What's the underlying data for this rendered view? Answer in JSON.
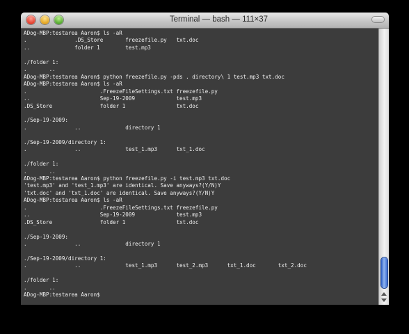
{
  "window": {
    "title": "Terminal — bash — 111×37"
  },
  "terminal": {
    "lines": [
      "ADog-MBP:testarea Aaron$ ls -aR",
      ".               .DS_Store       freezefile.py   txt.doc",
      "..              folder 1        test.mp3",
      "",
      "./folder 1:",
      ".       ..",
      "ADog-MBP:testarea Aaron$ python freezefile.py -pds . directory\\ 1 test.mp3 txt.doc",
      "ADog-MBP:testarea Aaron$ ls -aR",
      ".                       .FreezeFileSettings.txt freezefile.py",
      "..                      Sep-19-2009             test.mp3",
      ".DS_Store               folder 1                txt.doc",
      "",
      "./Sep-19-2009:",
      ".               ..              directory 1",
      "",
      "./Sep-19-2009/directory 1:",
      ".               ..              test_1.mp3      txt_1.doc",
      "",
      "./folder 1:",
      ".       ..",
      "ADog-MBP:testarea Aaron$ python freezefile.py -i test.mp3 txt.doc",
      "'test.mp3' and 'test_1.mp3' are identical. Save anyways?(Y/N)Y",
      "'txt.doc' and 'txt_1.doc' are identical. Save anyways?(Y/N)Y",
      "ADog-MBP:testarea Aaron$ ls -aR",
      ".                       .FreezeFileSettings.txt freezefile.py",
      "..                      Sep-19-2009             test.mp3",
      ".DS_Store               folder 1                txt.doc",
      "",
      "./Sep-19-2009:",
      ".               ..              directory 1",
      "",
      "./Sep-19-2009/directory 1:",
      ".               ..              test_1.mp3      test_2.mp3      txt_1.doc       txt_2.doc",
      "",
      "./folder 1:",
      ".       ..",
      "ADog-MBP:testarea Aaron$"
    ]
  }
}
